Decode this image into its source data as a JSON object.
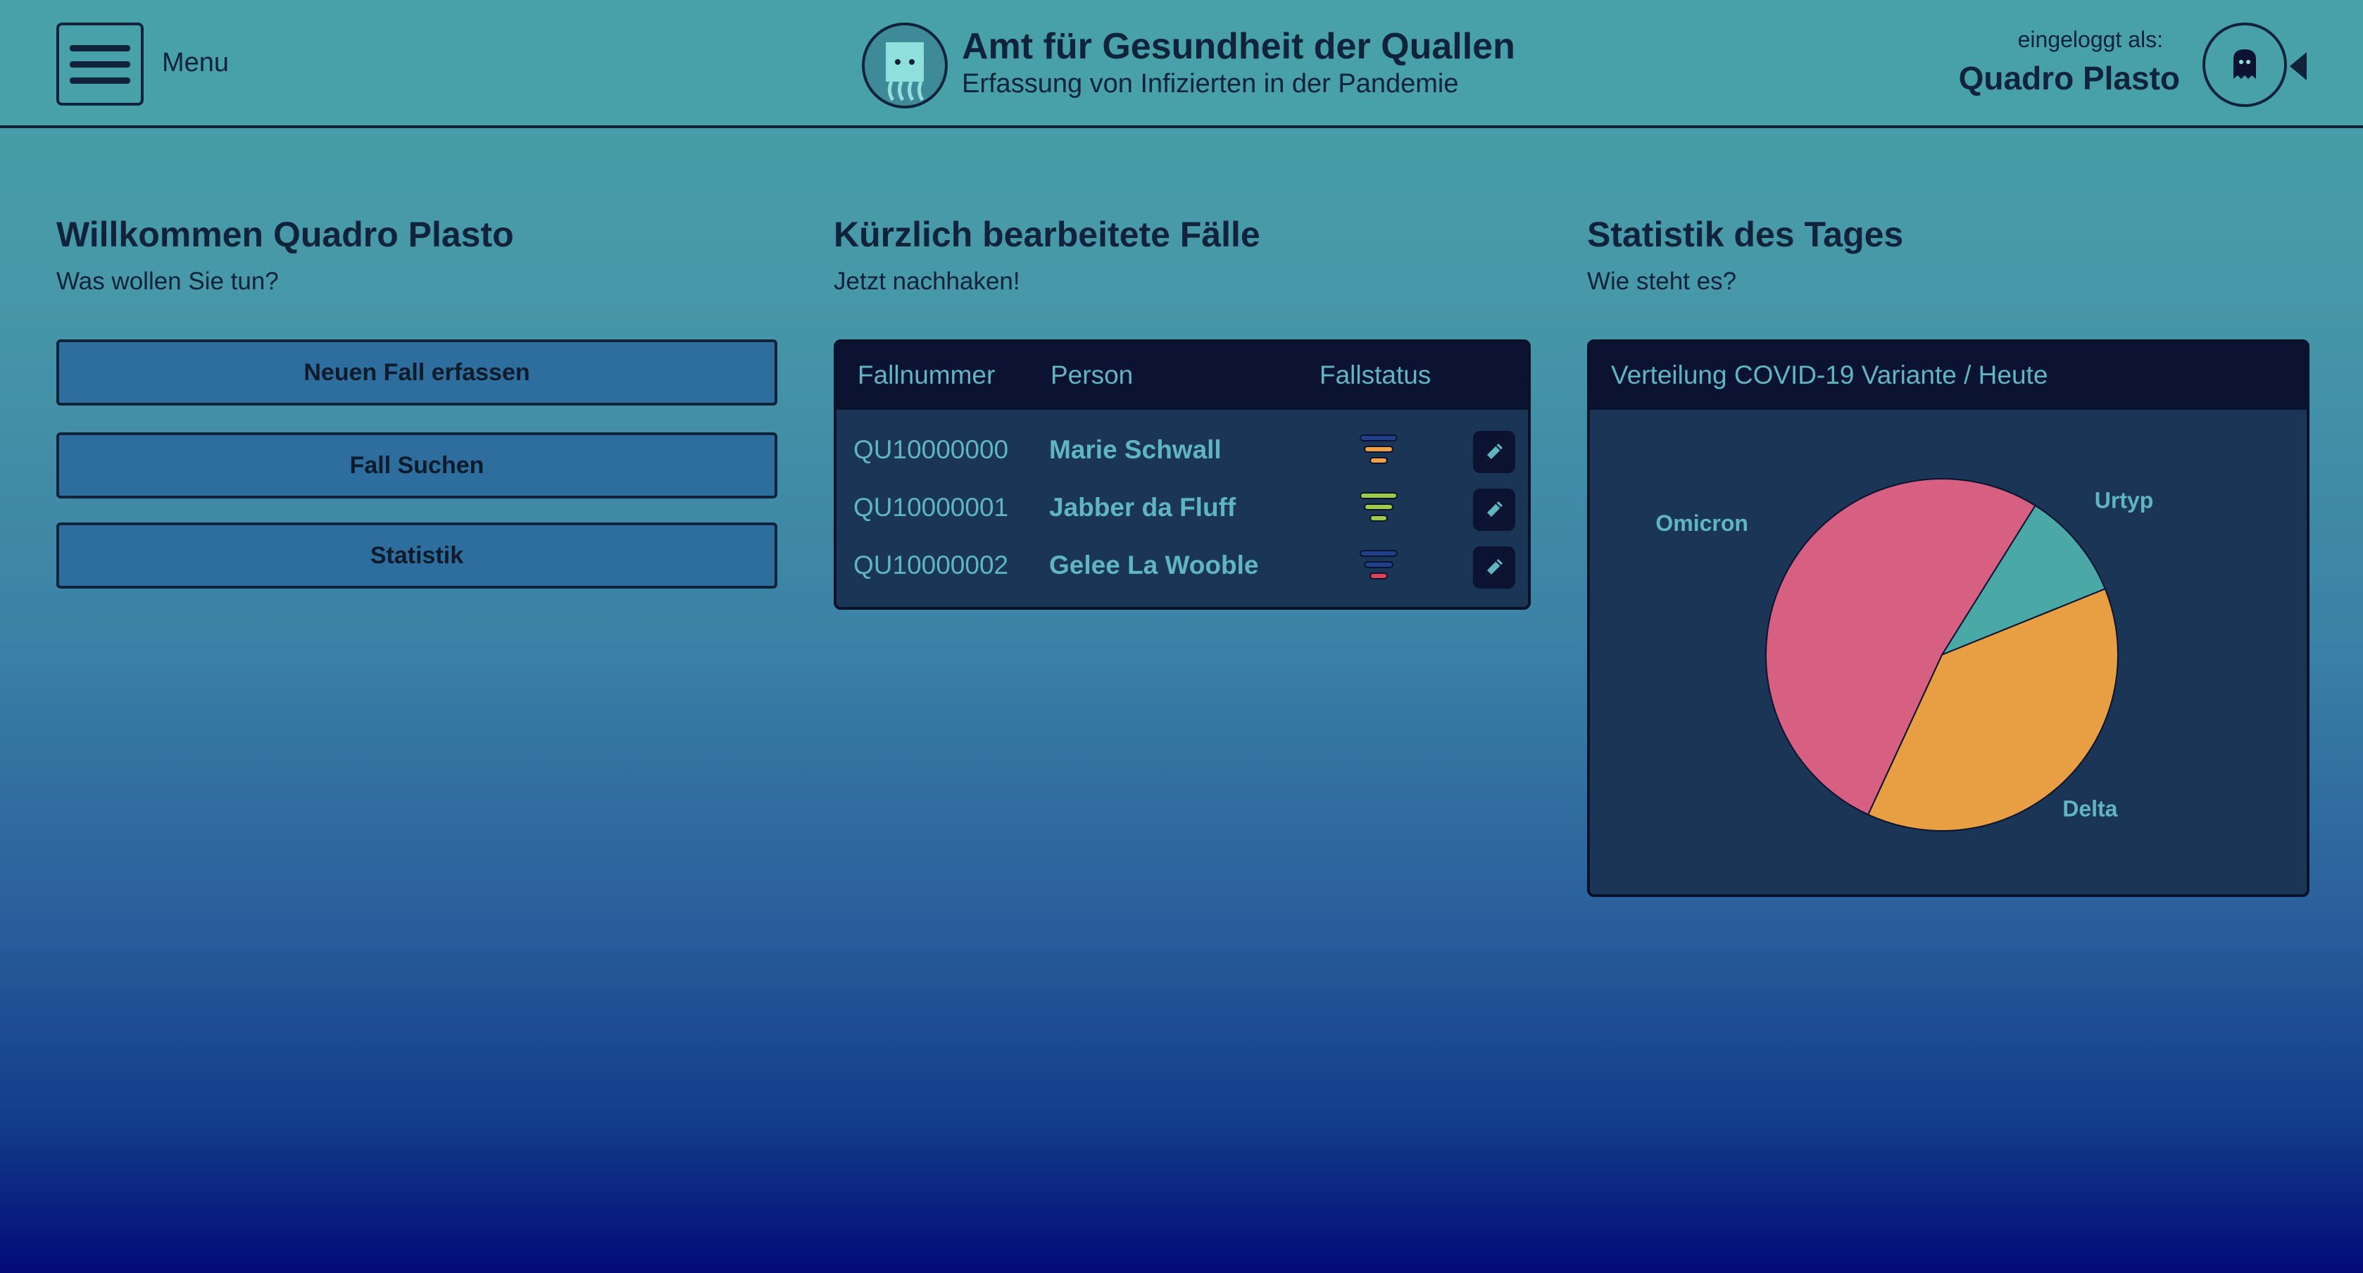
{
  "header": {
    "menu_label": "Menu",
    "title": "Amt für Gesundheit der Quallen",
    "subtitle": "Erfassung von Infizierten in der Pandemie",
    "logged_in_label": "eingeloggt als:",
    "user_name": "Quadro Plasto"
  },
  "welcome": {
    "heading_prefix": "Willkommen",
    "heading_name": "Quadro Plasto",
    "lead": "Was wollen Sie tun?",
    "buttons": [
      "Neuen Fall erfassen",
      "Fall Suchen",
      "Statistik"
    ]
  },
  "recent": {
    "heading": "Kürzlich bearbeitete Fälle",
    "lead": "Jetzt nachhaken!",
    "columns": [
      "Fallnummer",
      "Person",
      "Fallstatus"
    ],
    "rows": [
      {
        "case": "QU10000000",
        "person": "Marie Schwall",
        "status_color": "#f0a040"
      },
      {
        "case": "QU10000001",
        "person": "Jabber da Fluff",
        "status_color": "#9ccc45"
      },
      {
        "case": "QU10000002",
        "person": "Gelee La Wooble",
        "status_color": "#e0405a"
      }
    ]
  },
  "stats": {
    "heading": "Statistik des Tages",
    "lead": "Wie steht es?"
  },
  "chart_data": {
    "type": "pie",
    "title": "Verteilung COVID-19 Variante / Heute",
    "slices": [
      {
        "label": "Urtyp",
        "value": 10,
        "color": "#4aa8a6"
      },
      {
        "label": "Delta",
        "value": 38,
        "color": "#e89e42"
      },
      {
        "label": "Omicron",
        "value": 52,
        "color": "#d65f82"
      }
    ]
  },
  "colors": {
    "accent": "#5fb6c1",
    "card": "#1a3556",
    "card_header": "#0b1330",
    "button": "#2e6e9e",
    "dark": "#10233a"
  }
}
